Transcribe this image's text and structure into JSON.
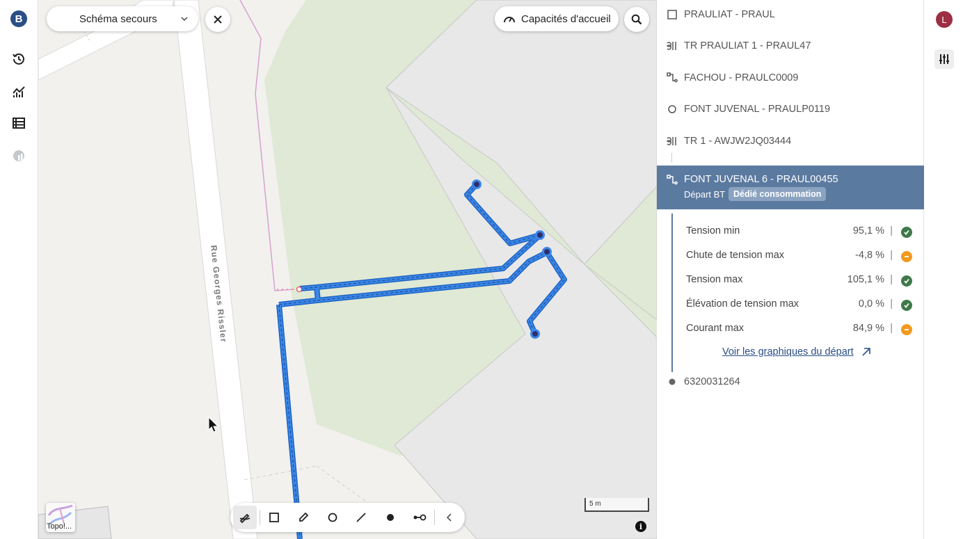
{
  "leftnav": {
    "brand_letter": "B",
    "items": [
      {
        "icon": "history-icon"
      },
      {
        "icon": "chart-icon"
      },
      {
        "icon": "table-icon"
      },
      {
        "icon": "globe-chart-icon"
      }
    ]
  },
  "map": {
    "scheme_select": "Schéma secours",
    "capacity_button": "Capacités d'accueil",
    "street_label": "Rue Georges Rissler",
    "scale_label": "5 m",
    "topo_label": "Topo!...",
    "info_label": "i"
  },
  "toolbar": {
    "tools": [
      "draw-select-icon",
      "rectangle-icon",
      "pencil-icon",
      "circle-icon",
      "line-icon",
      "point-icon",
      "connector-icon",
      "collapse-icon"
    ]
  },
  "panel": {
    "tree": [
      {
        "icon": "square-icon",
        "label": "PRAULIAT - PRAUL"
      },
      {
        "icon": "transformer-icon",
        "label": "TR PRAULIAT 1 - PRAUL47"
      },
      {
        "icon": "feeder-icon",
        "label": "FACHOU - PRAULC0009"
      },
      {
        "icon": "circle-outline-icon",
        "label": "FONT JUVENAL - PRAULP0119"
      },
      {
        "icon": "transformer-icon",
        "label": "TR 1 - AWJW2JQ03444"
      }
    ],
    "selected": {
      "title": "FONT JUVENAL 6 - PRAUL00455",
      "subtitle": "Départ BT",
      "badge": "Dédié consommation"
    },
    "metrics": [
      {
        "label": "Tension min",
        "value": "95,1 %",
        "status": "ok"
      },
      {
        "label": "Chute de tension max",
        "value": "-4,8 %",
        "status": "warning"
      },
      {
        "label": "Tension max",
        "value": "105,1 %",
        "status": "ok"
      },
      {
        "label": "Élévation de tension max",
        "value": "0,0 %",
        "status": "ok"
      },
      {
        "label": "Courant max",
        "value": "84,9 %",
        "status": "warning"
      }
    ],
    "graph_link": "Voir les graphiques du départ",
    "last_item": "6320031264"
  },
  "user": {
    "avatar_letter": "L"
  },
  "colors": {
    "accent": "#5b7aa0",
    "brand": "#2a4e86",
    "ok": "#3f7a4a",
    "warning": "#f29a1e",
    "route": "#3b88e8",
    "avatar": "#9c2f43"
  }
}
